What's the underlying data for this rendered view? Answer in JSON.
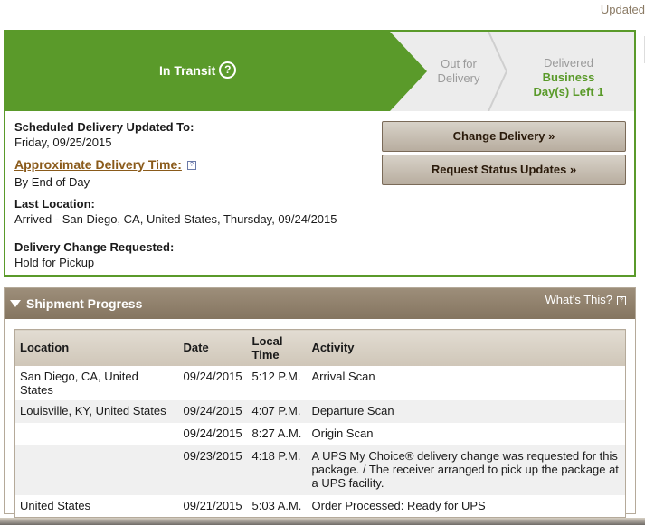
{
  "header": {
    "updated": "Updated"
  },
  "progress": {
    "current": "In Transit",
    "help_symbol": "?",
    "next_stage": [
      "Out for",
      "Delivery"
    ],
    "final_stage": {
      "label": "Delivered",
      "note": "Business Day(s) Left 1"
    },
    "colors": {
      "active": "#5a9a2a",
      "inactive": "#ececec"
    }
  },
  "details": {
    "scheduled_label": "Scheduled Delivery Updated To:",
    "scheduled_value": "Friday, 09/25/2015",
    "approx_label": "Approximate Delivery Time:",
    "approx_help": "?",
    "approx_value": "By End of Day",
    "last_location_label": "Last Location:",
    "last_location_value": "Arrived - San Diego, CA, United States, Thursday, 09/24/2015",
    "change_label": "Delivery Change Requested:",
    "change_value": "Hold for Pickup"
  },
  "buttons": {
    "change_delivery": "Change Delivery »",
    "request_updates": "Request Status Updates »"
  },
  "shipment_progress": {
    "title": "Shipment Progress",
    "whats_this": "What's This?",
    "help": "?",
    "columns": [
      "Location",
      "Date",
      "Local Time",
      "Activity"
    ],
    "rows": [
      {
        "location": "San Diego, CA, United States",
        "date": "09/24/2015",
        "time": "5:12 P.M.",
        "activity": "Arrival Scan"
      },
      {
        "location": "Louisville, KY, United States",
        "date": "09/24/2015",
        "time": "4:07 P.M.",
        "activity": "Departure Scan"
      },
      {
        "location": "",
        "date": "09/24/2015",
        "time": "8:27 A.M.",
        "activity": "Origin Scan"
      },
      {
        "location": "",
        "date": "09/23/2015",
        "time": "4:18 P.M.",
        "activity": "A UPS My Choice® delivery change was requested for this package. / The receiver arranged to pick up the package at a UPS facility."
      },
      {
        "location": "United States",
        "date": "09/21/2015",
        "time": "5:03 A.M.",
        "activity": "Order Processed: Ready for UPS"
      }
    ]
  }
}
